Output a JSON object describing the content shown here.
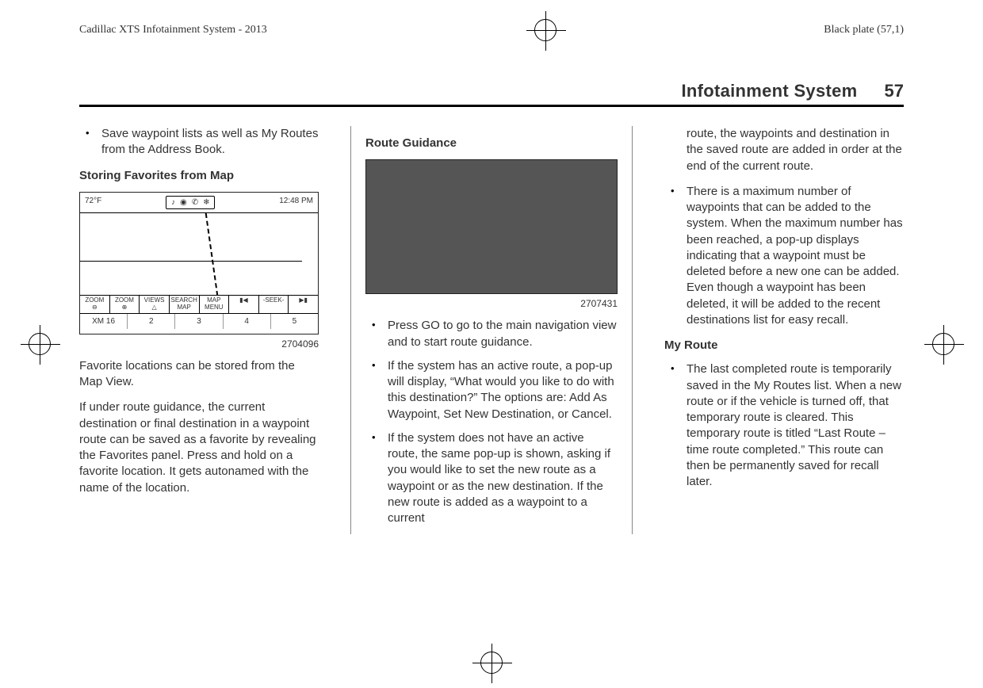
{
  "header_left": "Cadillac XTS Infotainment System - 2013",
  "header_right": "Black plate (57,1)",
  "section_title": "Infotainment System",
  "page_number": "57",
  "col1": {
    "bullet1": "Save waypoint lists as well as My Routes from the Address Book.",
    "h_store": "Storing Favorites from Map",
    "fig_caption": "2704096",
    "map_top_temp": "72°F",
    "map_top_time": "12:48 PM",
    "map_btn_zoom_out": "ZOOM\n⊖",
    "map_btn_zoom_in": "ZOOM\n⊕",
    "map_btn_views": "VIEWS\n△",
    "map_btn_search": "SEARCH\nMAP",
    "map_btn_menu": "MAP\nMENU",
    "map_btn_prev": "▮◀",
    "map_btn_seek": "-SEEK-",
    "map_btn_next": "▶▮",
    "map_bot_xm": "XM 16",
    "map_bot_2": "2",
    "map_bot_3": "3",
    "map_bot_4": "4",
    "map_bot_5": "5",
    "para1": "Favorite locations can be stored from the Map View.",
    "para2": "If under route guidance, the current destination or final destination in a waypoint route can be saved as a favorite by revealing the Favorites panel. Press and hold on a favorite location. It gets autonamed with the name of the location."
  },
  "col2": {
    "h_route": "Route Guidance",
    "fig_caption": "2707431",
    "bullet1": "Press GO to go to the main navigation view and to start route guidance.",
    "bullet2": "If the system has an active route, a pop-up will display, “What would you like to do with this destination?” The options are: Add As Waypoint, Set New Destination, or Cancel.",
    "bullet3": "If the system does not have an active route, the same pop-up is shown, asking if you would like to set the new route as a waypoint or as the new destination. If the new route is added as a waypoint to a current"
  },
  "col3": {
    "cont": "route, the waypoints and destination in the saved route are added in order at the end of the current route.",
    "bullet1": "There is a maximum number of waypoints that can be added to the system. When the maximum number has been reached, a pop-up displays indicating that a waypoint must be deleted before a new one can be added. Even though a waypoint has been deleted, it will be added to the recent destinations list for easy recall.",
    "h_myroute": "My Route",
    "bullet2": "The last completed route is temporarily saved in the My Routes list. When a new route or if the vehicle is turned off, that temporary route is cleared. This temporary route is titled “Last Route – time route completed.” This route can then be permanently saved for recall later."
  }
}
